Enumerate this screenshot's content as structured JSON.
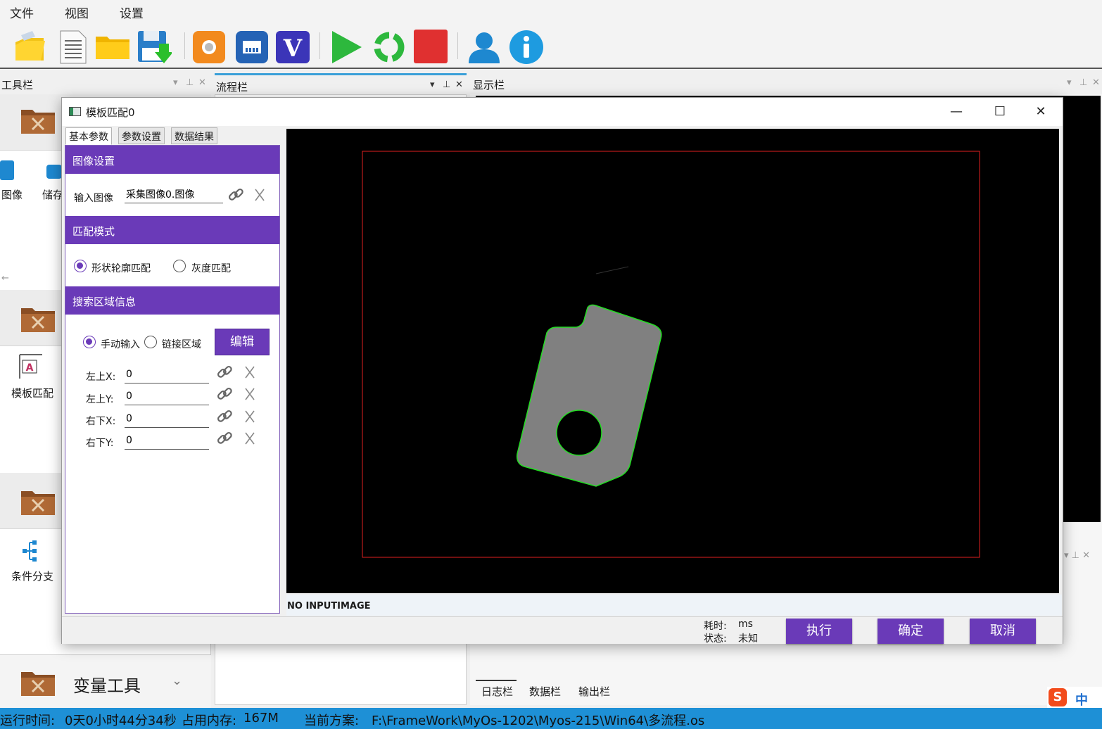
{
  "menu": [
    "文件",
    "视图",
    "设置"
  ],
  "toolbar": {
    "icons": [
      "open-folder-icon",
      "new-document-icon",
      "folder-icon",
      "save-download-icon",
      "camera-icon",
      "network-icon",
      "v-icon",
      "run-icon",
      "loop-icon",
      "stop-icon",
      "user-icon",
      "info-icon"
    ],
    "colors": {
      "run": "#2db83d",
      "stop": "#e03030",
      "info": "#1e9be0",
      "camera": "#f28a1e",
      "network": "#2563b5",
      "v": "#3b35b8"
    }
  },
  "panes": {
    "tools_title": "工具栏",
    "flow_title": "流程栏",
    "display_title": "显示栏"
  },
  "left_tools": {
    "image_label": "图像",
    "store_label": "储存",
    "template_match_label": "模板匹配",
    "branch_label": "条件分支",
    "variable_tools_label": "变量工具"
  },
  "bottom_tabs": [
    "日志栏",
    "数据栏",
    "输出栏"
  ],
  "status": {
    "runtime_label": "运行时间:",
    "runtime_value": "0天0小时44分34秒",
    "memory_label": "占用内存:",
    "memory_value": "167M",
    "scheme_label": "当前方案:",
    "scheme_value": "F:\\FrameWork\\MyOs-1202\\Myos-215\\Win64\\多流程.os"
  },
  "ime": {
    "label": "中",
    "logo": "S"
  },
  "dialog": {
    "title": "模板匹配0",
    "tabs": [
      "基本参数",
      "参数设置",
      "数据结果"
    ],
    "image_section": "图像设置",
    "input_image_label": "输入图像",
    "input_image_value": "采集图像0.图像",
    "match_mode_section": "匹配模式",
    "mode_shape": "形状轮廓匹配",
    "mode_gray": "灰度匹配",
    "search_section": "搜索区域信息",
    "manual_input": "手动输入",
    "link_region": "链接区域",
    "edit_button": "编辑",
    "fields": [
      {
        "label": "左上X:",
        "value": "0"
      },
      {
        "label": "左上Y:",
        "value": "0"
      },
      {
        "label": "右下X:",
        "value": "0"
      },
      {
        "label": "右下Y:",
        "value": "0"
      }
    ],
    "canvas_status": "NO INPUTIMAGE",
    "elapsed_label": "耗时:",
    "elapsed_unit": "ms",
    "state_label": "状态:",
    "state_value": "未知",
    "execute_button": "执行",
    "ok_button": "确定",
    "cancel_button": "取消",
    "colors": {
      "accent": "#6a3ab8",
      "roi": "#e02020",
      "contour": "#22dd22",
      "part": "#808080"
    }
  }
}
